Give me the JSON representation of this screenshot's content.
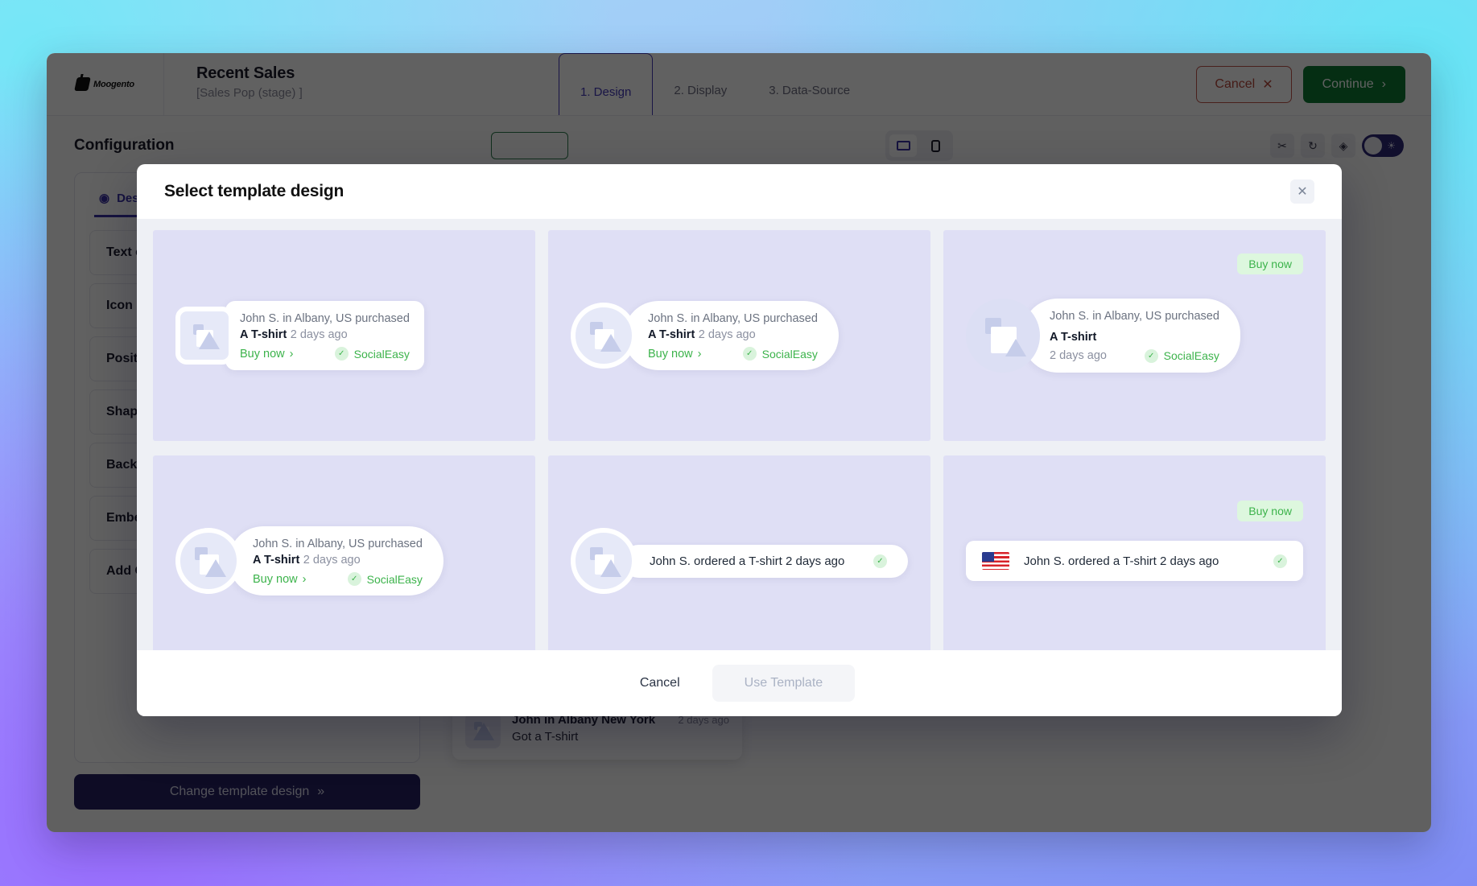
{
  "app": {
    "brand": "Moogento",
    "page_title": "Recent Sales",
    "page_subtitle": "[Sales Pop (stage) ]",
    "steps": [
      {
        "label": "1. Design",
        "active": true
      },
      {
        "label": "2. Display",
        "active": false
      },
      {
        "label": "3. Data-Source",
        "active": false
      }
    ],
    "cancel_button": "Cancel",
    "cancel_icon": "close-x-icon",
    "continue_button": "Continue",
    "continue_icon": "chevron-right-icon",
    "config_label": "Configuration",
    "desktop_icon": "monitor-icon",
    "mobile_icon": "phone-icon",
    "mini_icons": [
      "cut-icon",
      "undo-icon",
      "eyedropper-icon"
    ],
    "dark_mode_icon": "sun-icon"
  },
  "sidebar": {
    "tab_label": "Design",
    "tab_icon": "palette-icon",
    "items": [
      {
        "label": "Text editor",
        "help": false
      },
      {
        "label": "Icon",
        "help": true,
        "help_glyph": "?"
      },
      {
        "label": "Position",
        "help": false
      },
      {
        "label": "Shape & Size",
        "help": false
      },
      {
        "label": "Background",
        "help": false
      },
      {
        "label": "Embed",
        "help": false
      },
      {
        "label": "Add Custom CSS",
        "help": false
      }
    ],
    "change_template_button": "Change template design",
    "change_template_icon": "double-chevron-right-icon"
  },
  "preview_toast": {
    "name": "John in Albany New York",
    "time": "2 days ago",
    "subtitle": "Got a T-shirt",
    "close_icon": "close-x-icon",
    "thumb_icon": "image-placeholder-icon"
  },
  "modal": {
    "title": "Select template design",
    "close_icon": "close-x-icon",
    "cancel_button": "Cancel",
    "use_template_button": "Use Template",
    "templates": [
      {
        "id": "tpl-1",
        "layout": "square-thumb-card",
        "line1": "John S. in Albany, US purchased",
        "product": "A T-shirt",
        "ago": "2 days ago",
        "buy_now": "Buy now",
        "buy_icon": "chevron-right-icon",
        "brand": "SocialEasy",
        "brand_icon": "check-circle-icon",
        "badge": null
      },
      {
        "id": "tpl-2",
        "layout": "circle-thumb-pill",
        "line1": "John S. in Albany, US purchased",
        "product": "A T-shirt",
        "ago": "2 days ago",
        "buy_now": "Buy now",
        "buy_icon": "chevron-right-icon",
        "brand": "SocialEasy",
        "brand_icon": "check-circle-icon",
        "badge": null
      },
      {
        "id": "tpl-3",
        "layout": "circle-thumb-stacked",
        "line1": "John S. in Albany, US purchased",
        "product": "A T-shirt",
        "ago": "2 days ago",
        "buy_now": null,
        "brand": "SocialEasy",
        "brand_icon": "check-circle-icon",
        "badge": "Buy now"
      },
      {
        "id": "tpl-4",
        "layout": "circle-thumb-pill",
        "line1": "John S. in Albany, US purchased",
        "product": "A T-shirt",
        "ago": "2 days ago",
        "buy_now": "Buy now",
        "buy_icon": "chevron-right-icon",
        "brand": "SocialEasy",
        "brand_icon": "check-circle-icon",
        "badge": null
      },
      {
        "id": "tpl-5",
        "layout": "circle-thumb-oneline",
        "text": "John S. ordered a T-shirt 2 days ago",
        "brand_icon": "check-circle-icon",
        "badge": null
      },
      {
        "id": "tpl-6",
        "layout": "flag-oneline",
        "text": "John S. ordered a T-shirt 2 days ago",
        "flag_icon": "us-flag-icon",
        "brand_icon": "check-circle-icon",
        "badge": "Buy now"
      }
    ]
  },
  "colors": {
    "accent_purple": "#3b33a5",
    "green": "#3cb34b",
    "continue_green": "#0f7a34",
    "cancel_red": "#b6483c",
    "template_bg": "#dfdff5"
  }
}
